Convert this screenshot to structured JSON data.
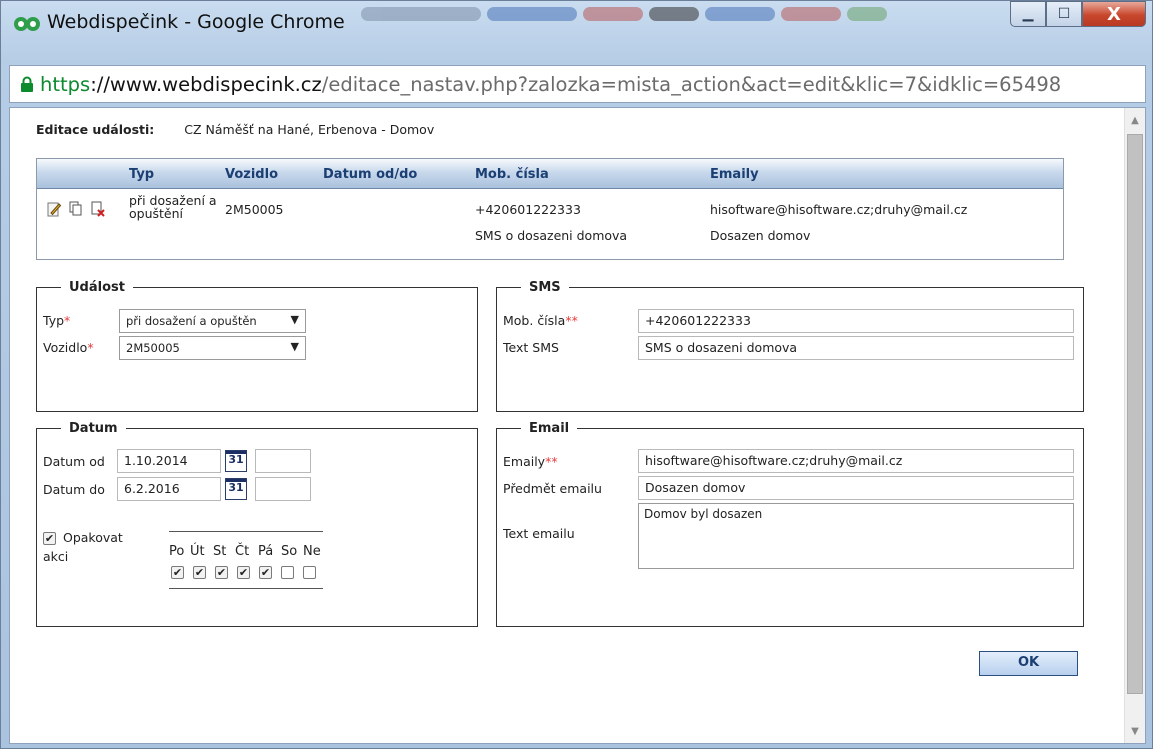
{
  "window": {
    "title": "Webdispečink - Google Chrome",
    "minimize_icon": "minimize-icon",
    "maximize_icon": "maximize-icon",
    "close_label": "X"
  },
  "address_bar": {
    "scheme": "https",
    "host": "://www.webdispecink.cz",
    "path": "/editace_nastav.php?zalozka=mista_action&act=edit&klic=7&idklic=65498"
  },
  "page": {
    "header_label": "Editace události:",
    "header_value": "CZ Náměšť na Hané, Erbenova - Domov"
  },
  "grid": {
    "columns": [
      "Typ",
      "Vozidlo",
      "Datum od/do",
      "Mob. čísla",
      "Emaily"
    ],
    "row": {
      "typ": "při dosažení a opuštění",
      "vozidlo": "2M50005",
      "datum": "",
      "mob_cislo": "+420601222333",
      "sms_text": "SMS o dosazeni domova",
      "email": "hisoftware@hisoftware.cz;druhy@mail.cz",
      "email_subject": "Dosazen domov"
    }
  },
  "udalost": {
    "legend": "Událost",
    "typ_label": "Typ",
    "typ_value": "při dosažení a opuštěn",
    "vozidlo_label": "Vozidlo",
    "vozidlo_value": "2M50005",
    "required_mark": "*"
  },
  "sms": {
    "legend": "SMS",
    "mob_label": "Mob. čísla",
    "mob_value": "+420601222333",
    "text_label": "Text SMS",
    "text_value": "SMS o dosazeni domova",
    "required_mark": "**"
  },
  "datum": {
    "legend": "Datum",
    "od_label": "Datum od",
    "od_value": "1.10.2014",
    "do_label": "Datum do",
    "do_value": "6.2.2016",
    "calendar_day": "31",
    "repeat_label_1": "Opakovat",
    "repeat_label_2": "akci",
    "repeat_checked": true,
    "days": [
      "Po",
      "Út",
      "St",
      "Čt",
      "Pá",
      "So",
      "Ne"
    ],
    "days_checked": [
      true,
      true,
      true,
      true,
      true,
      false,
      false
    ]
  },
  "email": {
    "legend": "Email",
    "emaily_label": "Emaily",
    "emaily_value": "hisoftware@hisoftware.cz;druhy@mail.cz",
    "subject_label": "Předmět emailu",
    "subject_value": "Dosazen domov",
    "text_label": "Text emailu",
    "text_value": "Domov byl dosazen",
    "required_mark": "**"
  },
  "actions": {
    "ok_label": "OK"
  }
}
